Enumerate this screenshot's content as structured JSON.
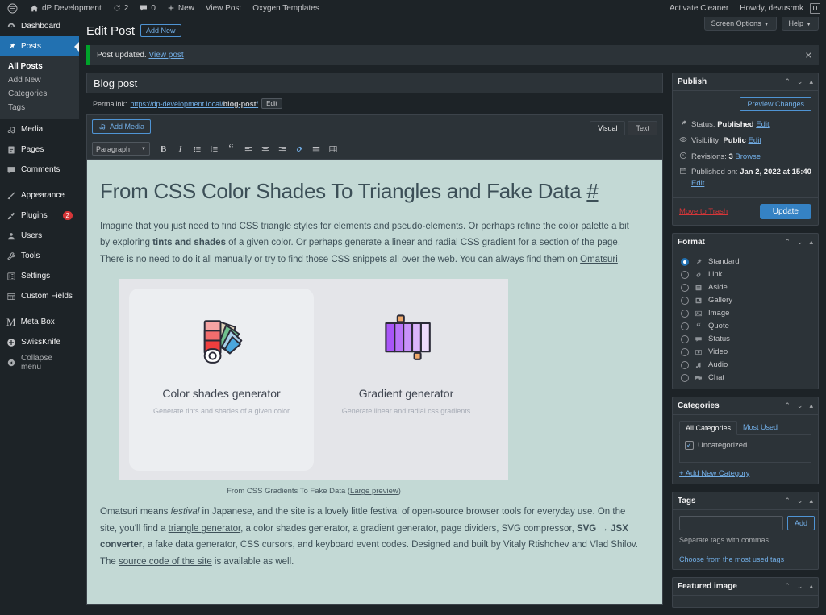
{
  "adminbar": {
    "logo_icon": "wordpress-logo-icon",
    "site_name": "dP Development",
    "site_icon": "home-icon",
    "updates_icon": "updates-icon",
    "updates_count": "2",
    "comments_icon": "comment-bubble-icon",
    "comments_count": "0",
    "new_icon": "plus-icon",
    "new_label": "New",
    "view_post_label": "View Post",
    "oxygen_label": "Oxygen Templates",
    "activate_cleaner_label": "Activate Cleaner",
    "howdy_label": "Howdy, devusrmk",
    "avatar_letter": "D"
  },
  "sidebar": {
    "items": [
      {
        "label": "Dashboard",
        "icon": "dashboard-icon"
      },
      {
        "label": "Posts",
        "icon": "pin-icon",
        "current": true
      },
      {
        "label": "Media",
        "icon": "media-icon"
      },
      {
        "label": "Pages",
        "icon": "pages-icon"
      },
      {
        "label": "Comments",
        "icon": "comment-bubble-icon"
      },
      {
        "label": "Appearance",
        "icon": "brush-icon"
      },
      {
        "label": "Plugins",
        "icon": "plug-icon",
        "badge": "2"
      },
      {
        "label": "Users",
        "icon": "users-icon"
      },
      {
        "label": "Tools",
        "icon": "wrench-icon"
      },
      {
        "label": "Settings",
        "icon": "settings-icon"
      },
      {
        "label": "Custom Fields",
        "icon": "custom-fields-icon"
      },
      {
        "label": "Meta Box",
        "icon": "metabox-m-icon"
      },
      {
        "label": "SwissKnife",
        "icon": "swissknife-icon"
      }
    ],
    "submenu": [
      {
        "label": "All Posts",
        "current": true
      },
      {
        "label": "Add New"
      },
      {
        "label": "Categories"
      },
      {
        "label": "Tags"
      }
    ],
    "collapse_label": "Collapse menu",
    "collapse_icon": "collapse-arrow-icon"
  },
  "header": {
    "page_title": "Edit Post",
    "add_new_label": "Add New",
    "screen_options_label": "Screen Options",
    "help_label": "Help"
  },
  "notice": {
    "text": "Post updated.",
    "link": "View post",
    "dismiss_icon": "close-icon"
  },
  "post": {
    "title_value": "Blog post",
    "title_placeholder": "Add title",
    "permalink_label": "Permalink:",
    "permalink_base": "https://dp-development.local/",
    "permalink_slug": "blog-post",
    "permalink_tail": "/",
    "permalink_edit_label": "Edit"
  },
  "editor": {
    "add_media_label": "Add Media",
    "add_media_icon": "media-icon",
    "tab_visual": "Visual",
    "tab_text": "Text",
    "paragraph_select": "Paragraph",
    "buttons": [
      {
        "name": "bold-button",
        "glyph": "B"
      },
      {
        "name": "italic-button",
        "glyph": "I"
      },
      {
        "name": "bulleted-list-button",
        "glyph": "list-ul-icon"
      },
      {
        "name": "numbered-list-button",
        "glyph": "list-ol-icon"
      },
      {
        "name": "blockquote-button",
        "glyph": "“"
      },
      {
        "name": "align-left-button",
        "glyph": "align-left-icon"
      },
      {
        "name": "align-center-button",
        "glyph": "align-center-icon"
      },
      {
        "name": "align-right-button",
        "glyph": "align-right-icon"
      },
      {
        "name": "insert-link-button",
        "glyph": "link-icon"
      },
      {
        "name": "read-more-button",
        "glyph": "read-more-icon"
      },
      {
        "name": "toolbar-toggle-button",
        "glyph": "toolbar-toggle-icon"
      }
    ]
  },
  "content": {
    "heading": "From CSS Color Shades To Triangles and Fake Data",
    "heading_anchor": "#",
    "para1_a": "Imagine that you just need to find CSS triangle styles for elements and pseudo-elements. Or perhaps refine the color palette a bit by exploring ",
    "para1_bold": "tints and shades",
    "para1_b": " of a given color. Or perhaps generate a linear and radial CSS gradient for a section of the page. There is no need to do it all manually or try to find those CSS snippets all over the web. You can always find them on ",
    "para1_link": "Omatsuri",
    "para1_c": ".",
    "figure": {
      "card1_title": "Color shades generator",
      "card1_sub": "Generate tints and shades of a given color",
      "card1_icon": "color-fan-deck-icon",
      "card2_title": "Gradient generator",
      "card2_sub": "Generate linear and radial css gradients",
      "card2_icon": "gradient-bars-icon"
    },
    "caption_text": "From CSS Gradients To Fake Data (",
    "caption_link": "Large preview",
    "caption_tail": ")",
    "para2_a": "Omatsuri means ",
    "para2_em": "festival",
    "para2_b": " in Japanese, and the site is a lovely little festival of open-source browser tools for everyday use. On the site, you'll find a ",
    "para2_link1": "triangle generator",
    "para2_c": ", a color shades generator, a gradient generator, page dividers, SVG compressor, ",
    "para2_bold": "SVG → JSX converter",
    "para2_d": ", a fake data generator, CSS cursors, and keyboard event codes. Designed and built by Vitaly Rtishchev and Vlad Shilov. The ",
    "para2_link2": "source code of the site",
    "para2_e": " is available as well."
  },
  "publish": {
    "title": "Publish",
    "preview_label": "Preview Changes",
    "status_label": "Status:",
    "status_value": "Published",
    "status_edit": "Edit",
    "status_icon": "pin-icon",
    "visibility_label": "Visibility:",
    "visibility_value": "Public",
    "visibility_edit": "Edit",
    "visibility_icon": "eye-icon",
    "revisions_label": "Revisions:",
    "revisions_value": "3",
    "revisions_browse": "Browse",
    "revisions_icon": "clock-icon",
    "published_label": "Published on:",
    "published_value": "Jan 2, 2022 at 15:40",
    "published_edit": "Edit",
    "published_icon": "calendar-icon",
    "trash_label": "Move to Trash",
    "update_label": "Update"
  },
  "format": {
    "title": "Format",
    "options": [
      {
        "label": "Standard",
        "icon": "pin-icon",
        "selected": true
      },
      {
        "label": "Link",
        "icon": "link-icon",
        "selected": false
      },
      {
        "label": "Aside",
        "icon": "aside-icon",
        "selected": false
      },
      {
        "label": "Gallery",
        "icon": "gallery-icon",
        "selected": false
      },
      {
        "label": "Image",
        "icon": "image-icon",
        "selected": false
      },
      {
        "label": "Quote",
        "icon": "quote-icon",
        "selected": false
      },
      {
        "label": "Status",
        "icon": "status-bubble-icon",
        "selected": false
      },
      {
        "label": "Video",
        "icon": "video-icon",
        "selected": false
      },
      {
        "label": "Audio",
        "icon": "audio-note-icon",
        "selected": false
      },
      {
        "label": "Chat",
        "icon": "chat-icon",
        "selected": false
      }
    ]
  },
  "categories": {
    "title": "Categories",
    "tab_all": "All Categories",
    "tab_most_used": "Most Used",
    "items": [
      {
        "label": "Uncategorized",
        "checked": true
      }
    ],
    "add_new_label": "+ Add New Category"
  },
  "tags": {
    "title": "Tags",
    "input_value": "",
    "add_label": "Add",
    "hint": "Separate tags with commas",
    "choose_link": "Choose from the most used tags"
  },
  "featured_image": {
    "title": "Featured image"
  },
  "colors": {
    "admin_bg": "#1d2327",
    "panel_bg": "#2c3338",
    "accent_blue": "#2271b1",
    "link_blue": "#72aee6",
    "notice_green": "#00a32a",
    "danger_red": "#d63638",
    "canvas_bg": "#c3d9d5"
  }
}
